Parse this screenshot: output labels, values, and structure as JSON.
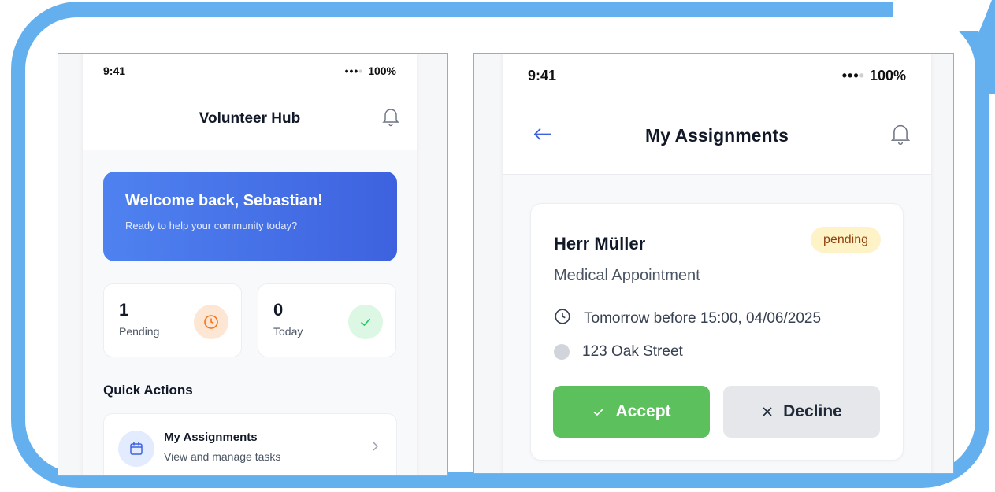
{
  "left_screen": {
    "status": {
      "time": "9:41",
      "battery": "100%"
    },
    "header": {
      "title": "Volunteer Hub"
    },
    "welcome": {
      "title": "Welcome back, Sebastian!",
      "subtitle": "Ready to help your community today?"
    },
    "stats": [
      {
        "value": "1",
        "label": "Pending",
        "icon": "clock-icon",
        "color": "#f97316"
      },
      {
        "value": "0",
        "label": "Today",
        "icon": "check-icon",
        "color": "#22c55e"
      }
    ],
    "quick_actions": {
      "title": "Quick Actions",
      "items": [
        {
          "title": "My Assignments",
          "subtitle": "View and manage tasks",
          "icon": "calendar-icon"
        }
      ]
    }
  },
  "right_screen": {
    "status": {
      "time": "9:41",
      "battery": "100%"
    },
    "header": {
      "title": "My Assignments"
    },
    "assignment": {
      "name": "Herr Müller",
      "status": "pending",
      "type": "Medical Appointment",
      "time": "Tomorrow before 15:00, 04/06/2025",
      "address": "123 Oak Street",
      "accept_label": "Accept",
      "decline_label": "Decline"
    }
  },
  "colors": {
    "frame": "#64b0ee",
    "primary": "#3e62df",
    "accept": "#5cc05c",
    "pending_badge": "#fdf3c6"
  }
}
